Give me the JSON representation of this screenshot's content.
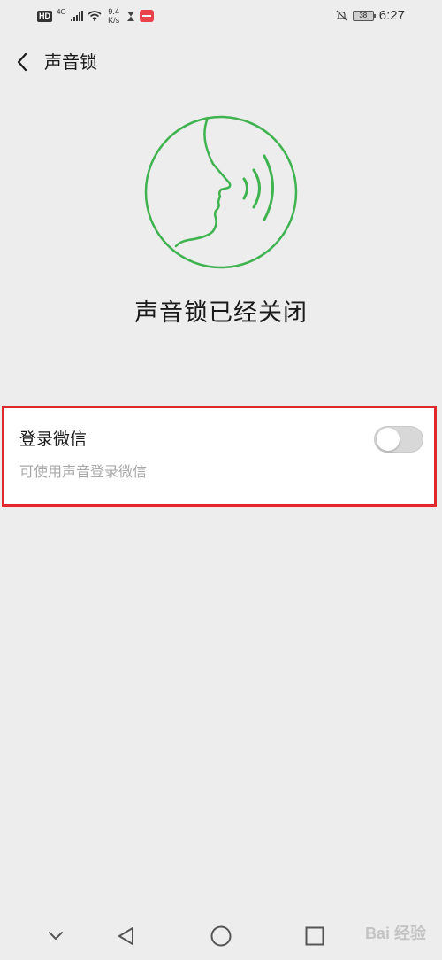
{
  "status_bar": {
    "hd_badge": "HD",
    "network": "4G",
    "speed_value": "9.4",
    "speed_unit": "K/s",
    "battery": "38",
    "time": "6:27"
  },
  "header": {
    "title": "声音锁"
  },
  "main": {
    "status_title": "声音锁已经关闭",
    "setting": {
      "label": "登录微信",
      "description": "可使用声音登录微信",
      "enabled": false
    }
  },
  "watermark": {
    "text": "Bai 经验"
  },
  "colors": {
    "accent_green": "#3fb34f",
    "highlight_red": "#e0292b",
    "toggle_off": "#d8d8d8",
    "background": "#ededed"
  },
  "icons": {
    "back": "chevron-left-icon",
    "illustration": "voice-face-icon",
    "nav_collapse": "chevron-down-icon",
    "nav_back": "triangle-back-icon",
    "nav_home": "circle-home-icon",
    "nav_recent": "square-recent-icon"
  }
}
